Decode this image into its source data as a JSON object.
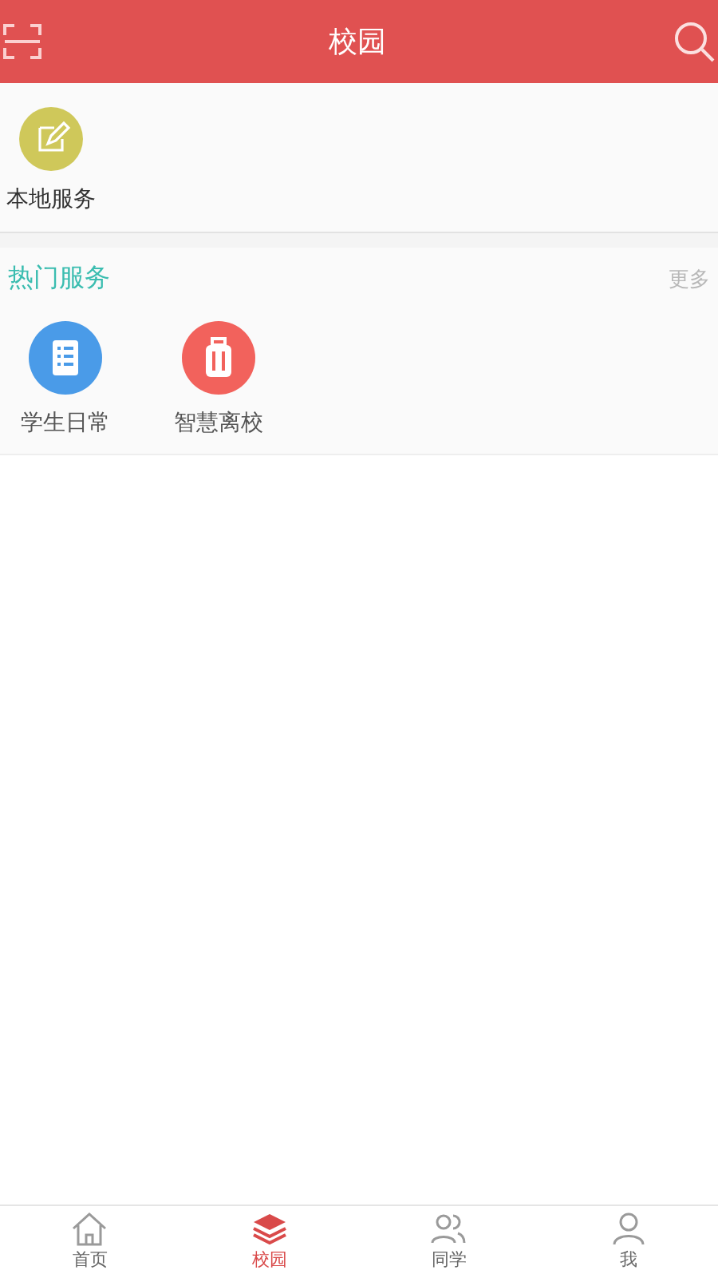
{
  "header": {
    "title": "校园"
  },
  "local_services": [
    {
      "label": "本地服务",
      "kind": "edit"
    }
  ],
  "hot_services": {
    "title": "热门服务",
    "more": "更多",
    "items": [
      {
        "label": "学生日常",
        "kind": "list"
      },
      {
        "label": "智慧离校",
        "kind": "luggage"
      }
    ]
  },
  "tab_bar": [
    {
      "label": "首页",
      "kind": "home",
      "selected": false
    },
    {
      "label": "校园",
      "kind": "layers",
      "selected": true
    },
    {
      "label": "同学",
      "kind": "people",
      "selected": false
    },
    {
      "label": "我",
      "kind": "person",
      "selected": false
    }
  ]
}
